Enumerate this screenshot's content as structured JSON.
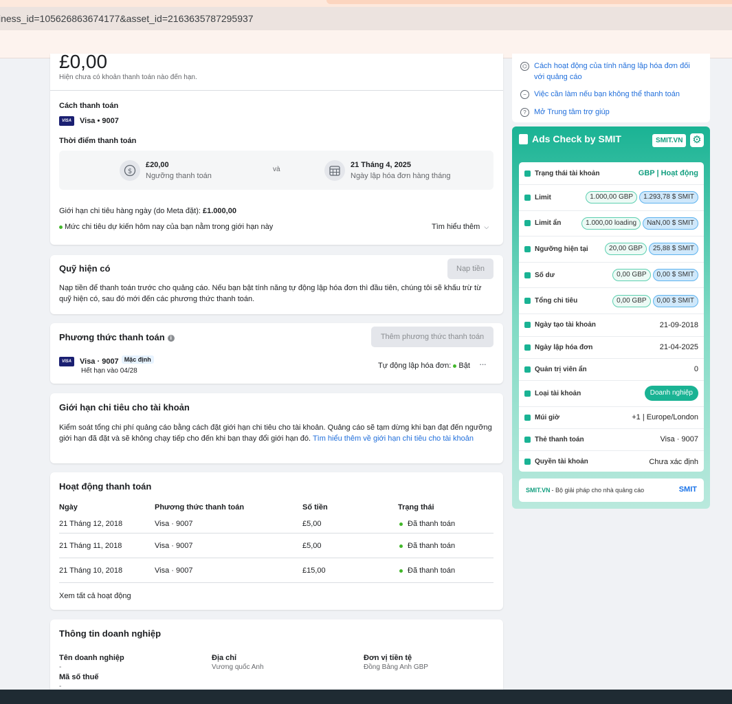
{
  "browser": {
    "url": "iness_id=105626863674177&asset_id=2163635787295937"
  },
  "billing": {
    "amount": "£0,00",
    "amount_note": "Hiện chưa có khoản thanh toán nào đến hạn.",
    "payment_method_title": "Cách thanh toán",
    "visa_badge": "VISA",
    "card": "Visa • 9007",
    "payment_time_title": "Thời điểm thanh toán",
    "threshold_value": "£20,00",
    "threshold_label": "Ngưỡng thanh toán",
    "and": "và",
    "bill_date_value": "21 Tháng 4, 2025",
    "bill_date_label": "Ngày lập hóa đơn hàng tháng",
    "daily_limit_text": "Giới hạn chi tiêu hàng ngày (do Meta đặt): ",
    "daily_limit_value": "£1.000,00",
    "daily_note": "Mức chi tiêu dự kiến hôm nay của bạn nằm trong giới hạn này",
    "learn_more": "Tìm hiểu thêm"
  },
  "funds": {
    "title": "Quỹ hiện có",
    "button": "Nạp tiền",
    "description": "Nạp tiền để thanh toán trước cho quảng cáo. Nếu bạn bật tính năng tự động lập hóa đơn thì đầu tiên, chúng tôi sẽ khấu trừ từ quỹ hiện có, sau đó mới đến các phương thức thanh toán."
  },
  "methods": {
    "title": "Phương thức thanh toán",
    "add_button": "Thêm phương thức thanh toán",
    "card": "Visa · 9007",
    "default_badge": "Mặc định",
    "expiry": "Hết hạn vào 04/28",
    "auto_bill_label": "Tự động lập hóa đơn:",
    "auto_bill_value": "Bật",
    "more": "···"
  },
  "limit": {
    "title": "Giới hạn chi tiêu cho tài khoản",
    "description": "Kiểm soát tổng chi phí quảng cáo bằng cách đặt giới hạn chi tiêu cho tài khoản. Quảng cáo sẽ tạm dừng khi bạn đạt đến ngưỡng giới hạn đã đặt và sẽ không chạy tiếp cho đến khi bạn thay đổi giới hạn đó. ",
    "link": "Tìm hiểu thêm về giới hạn chi tiêu cho tài khoản"
  },
  "activity": {
    "title": "Hoạt động thanh toán",
    "headers": [
      "Ngày",
      "Phương thức thanh toán",
      "Số tiền",
      "Trạng thái"
    ],
    "rows": [
      [
        "21 Tháng 12, 2018",
        "Visa · 9007",
        "£5,00",
        "Đã thanh toán"
      ],
      [
        "21 Tháng 11, 2018",
        "Visa · 9007",
        "£5,00",
        "Đã thanh toán"
      ],
      [
        "21 Tháng 10, 2018",
        "Visa · 9007",
        "£15,00",
        "Đã thanh toán"
      ]
    ],
    "view_all": "Xem tất cả hoạt động"
  },
  "business": {
    "title": "Thông tin doanh nghiệp",
    "name_label": "Tên doanh nghiệp",
    "name_value": "-",
    "address_label": "Địa chỉ",
    "address_value": "Vương quốc Anh",
    "currency_label": "Đơn vị tiền tệ",
    "currency_value": "Đồng Bảng Anh GBP",
    "tax_label": "Mã số thuế",
    "tax_value": "-"
  },
  "help": {
    "items": [
      "Cách hoạt động của tính năng lập hóa đơn đối với quảng cáo",
      "Việc cần làm nếu bạn không thể thanh toán",
      "Mở Trung tâm trợ giúp"
    ]
  },
  "smit": {
    "title": "Ads Check by SMIT",
    "site_pill": "SMIT.VN",
    "status_label": "Trạng thái tài khoản",
    "status_value": "GBP | Hoạt động",
    "limit_label": "Limit",
    "limit_gbp": "1.000,00 GBP",
    "limit_smit": "1.293,78 $ SMIT",
    "hidden_limit_label": "Limit ẩn",
    "hidden_limit_gbp": "1.000,00 loading",
    "hidden_limit_smit": "NaN,00 $ SMIT",
    "threshold_label": "Ngưỡng hiện tại",
    "threshold_gbp": "20,00 GBP",
    "threshold_smit": "25,88 $ SMIT",
    "balance_label": "Số dư",
    "balance_gbp": "0,00 GBP",
    "balance_smit": "0,00 $ SMIT",
    "total_label": "Tổng chi tiêu",
    "total_gbp": "0,00 GBP",
    "total_smit": "0,00 $ SMIT",
    "created_label": "Ngày tạo tài khoản",
    "created_value": "21-09-2018",
    "bill_label": "Ngày lập hóa đơn",
    "bill_value": "21-04-2025",
    "hidden_admin_label": "Quản trị viên ẩn",
    "hidden_admin_value": "0",
    "type_label": "Loại tài khoản",
    "type_value": "Doanh nghiệp",
    "tz_label": "Múi giờ",
    "tz_value": "+1 | Europe/London",
    "card_label": "Thẻ thanh toán",
    "card_value": "Visa · 9007",
    "rights_label": "Quyền tài khoản",
    "rights_value": "Chưa xác định",
    "footer_brand": "SMIT.VN",
    "footer_text": " - Bộ giải pháp cho nhà quảng cáo",
    "logo": "SMIT"
  },
  "colors": {
    "accent_green": "#1ab394",
    "link_blue": "#216fdb",
    "visa_navy": "#1a1f71"
  }
}
